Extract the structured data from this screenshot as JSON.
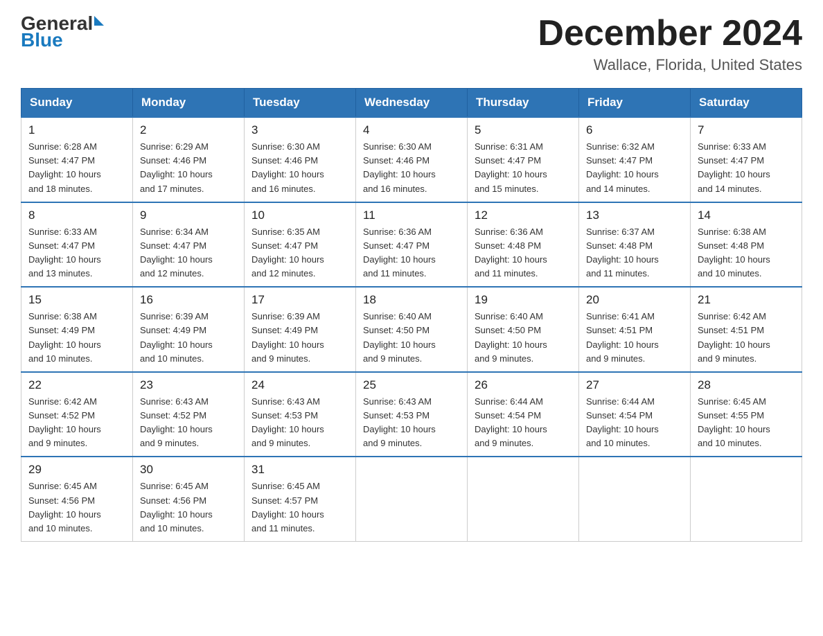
{
  "logo": {
    "line1": "General",
    "arrow": "▶",
    "line2": "Blue"
  },
  "title": "December 2024",
  "subtitle": "Wallace, Florida, United States",
  "days_of_week": [
    "Sunday",
    "Monday",
    "Tuesday",
    "Wednesday",
    "Thursday",
    "Friday",
    "Saturday"
  ],
  "weeks": [
    [
      {
        "day": "1",
        "sunrise": "6:28 AM",
        "sunset": "4:47 PM",
        "daylight": "10 hours and 18 minutes."
      },
      {
        "day": "2",
        "sunrise": "6:29 AM",
        "sunset": "4:46 PM",
        "daylight": "10 hours and 17 minutes."
      },
      {
        "day": "3",
        "sunrise": "6:30 AM",
        "sunset": "4:46 PM",
        "daylight": "10 hours and 16 minutes."
      },
      {
        "day": "4",
        "sunrise": "6:30 AM",
        "sunset": "4:46 PM",
        "daylight": "10 hours and 16 minutes."
      },
      {
        "day": "5",
        "sunrise": "6:31 AM",
        "sunset": "4:47 PM",
        "daylight": "10 hours and 15 minutes."
      },
      {
        "day": "6",
        "sunrise": "6:32 AM",
        "sunset": "4:47 PM",
        "daylight": "10 hours and 14 minutes."
      },
      {
        "day": "7",
        "sunrise": "6:33 AM",
        "sunset": "4:47 PM",
        "daylight": "10 hours and 14 minutes."
      }
    ],
    [
      {
        "day": "8",
        "sunrise": "6:33 AM",
        "sunset": "4:47 PM",
        "daylight": "10 hours and 13 minutes."
      },
      {
        "day": "9",
        "sunrise": "6:34 AM",
        "sunset": "4:47 PM",
        "daylight": "10 hours and 12 minutes."
      },
      {
        "day": "10",
        "sunrise": "6:35 AM",
        "sunset": "4:47 PM",
        "daylight": "10 hours and 12 minutes."
      },
      {
        "day": "11",
        "sunrise": "6:36 AM",
        "sunset": "4:47 PM",
        "daylight": "10 hours and 11 minutes."
      },
      {
        "day": "12",
        "sunrise": "6:36 AM",
        "sunset": "4:48 PM",
        "daylight": "10 hours and 11 minutes."
      },
      {
        "day": "13",
        "sunrise": "6:37 AM",
        "sunset": "4:48 PM",
        "daylight": "10 hours and 11 minutes."
      },
      {
        "day": "14",
        "sunrise": "6:38 AM",
        "sunset": "4:48 PM",
        "daylight": "10 hours and 10 minutes."
      }
    ],
    [
      {
        "day": "15",
        "sunrise": "6:38 AM",
        "sunset": "4:49 PM",
        "daylight": "10 hours and 10 minutes."
      },
      {
        "day": "16",
        "sunrise": "6:39 AM",
        "sunset": "4:49 PM",
        "daylight": "10 hours and 10 minutes."
      },
      {
        "day": "17",
        "sunrise": "6:39 AM",
        "sunset": "4:49 PM",
        "daylight": "10 hours and 9 minutes."
      },
      {
        "day": "18",
        "sunrise": "6:40 AM",
        "sunset": "4:50 PM",
        "daylight": "10 hours and 9 minutes."
      },
      {
        "day": "19",
        "sunrise": "6:40 AM",
        "sunset": "4:50 PM",
        "daylight": "10 hours and 9 minutes."
      },
      {
        "day": "20",
        "sunrise": "6:41 AM",
        "sunset": "4:51 PM",
        "daylight": "10 hours and 9 minutes."
      },
      {
        "day": "21",
        "sunrise": "6:42 AM",
        "sunset": "4:51 PM",
        "daylight": "10 hours and 9 minutes."
      }
    ],
    [
      {
        "day": "22",
        "sunrise": "6:42 AM",
        "sunset": "4:52 PM",
        "daylight": "10 hours and 9 minutes."
      },
      {
        "day": "23",
        "sunrise": "6:43 AM",
        "sunset": "4:52 PM",
        "daylight": "10 hours and 9 minutes."
      },
      {
        "day": "24",
        "sunrise": "6:43 AM",
        "sunset": "4:53 PM",
        "daylight": "10 hours and 9 minutes."
      },
      {
        "day": "25",
        "sunrise": "6:43 AM",
        "sunset": "4:53 PM",
        "daylight": "10 hours and 9 minutes."
      },
      {
        "day": "26",
        "sunrise": "6:44 AM",
        "sunset": "4:54 PM",
        "daylight": "10 hours and 9 minutes."
      },
      {
        "day": "27",
        "sunrise": "6:44 AM",
        "sunset": "4:54 PM",
        "daylight": "10 hours and 10 minutes."
      },
      {
        "day": "28",
        "sunrise": "6:45 AM",
        "sunset": "4:55 PM",
        "daylight": "10 hours and 10 minutes."
      }
    ],
    [
      {
        "day": "29",
        "sunrise": "6:45 AM",
        "sunset": "4:56 PM",
        "daylight": "10 hours and 10 minutes."
      },
      {
        "day": "30",
        "sunrise": "6:45 AM",
        "sunset": "4:56 PM",
        "daylight": "10 hours and 10 minutes."
      },
      {
        "day": "31",
        "sunrise": "6:45 AM",
        "sunset": "4:57 PM",
        "daylight": "10 hours and 11 minutes."
      },
      null,
      null,
      null,
      null
    ]
  ],
  "labels": {
    "sunrise": "Sunrise:",
    "sunset": "Sunset:",
    "daylight": "Daylight:"
  }
}
